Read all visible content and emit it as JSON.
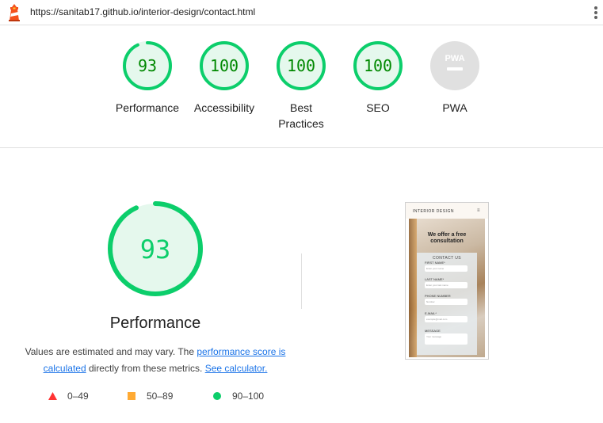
{
  "topbar": {
    "url": "https://sanitab17.github.io/interior-design/contact.html",
    "logo_icon": "lighthouse-icon",
    "menu_icon": "kebab-menu-icon"
  },
  "gauges": [
    {
      "label": "Performance",
      "score": "93"
    },
    {
      "label": "Accessibility",
      "score": "100"
    },
    {
      "label": "Best Practices",
      "score": "100"
    },
    {
      "label": "SEO",
      "score": "100"
    },
    {
      "label": "PWA",
      "score": "PWA"
    }
  ],
  "performance": {
    "score": "93",
    "title": "Performance",
    "desc_part1": "Values are estimated and may vary. The ",
    "desc_link1": "performance score is calculated",
    "desc_part2": " directly from these metrics. ",
    "desc_link2": "See calculator."
  },
  "legend": [
    {
      "range": "0–49",
      "color": "#ff3333",
      "icon": "triangle-icon"
    },
    {
      "range": "50–89",
      "color": "#ffaa33",
      "icon": "square-icon"
    },
    {
      "range": "90–100",
      "color": "#0cce6b",
      "icon": "circle-icon"
    }
  ],
  "colors": {
    "pass": "#0cce6b",
    "pass_text": "#008800",
    "pass_fill": "#e5f8ed",
    "pwa_gray": "#e0e0e0"
  },
  "thumbnail": {
    "brand": "INTERIOR  DESIGN",
    "menu": "≡",
    "heading": "We offer a free consultation",
    "card_title": "CONTACT US",
    "fields": [
      {
        "label": "FIRST NAME*",
        "placeholder": "Enter your name"
      },
      {
        "label": "LAST NAME*",
        "placeholder": "Enter your last name"
      },
      {
        "label": "PHONE NUMBER",
        "placeholder": "Number"
      },
      {
        "label": "E-MAIL*",
        "placeholder": "example@mail.com"
      },
      {
        "label": "MESSAGE",
        "placeholder": "Your message"
      }
    ]
  }
}
